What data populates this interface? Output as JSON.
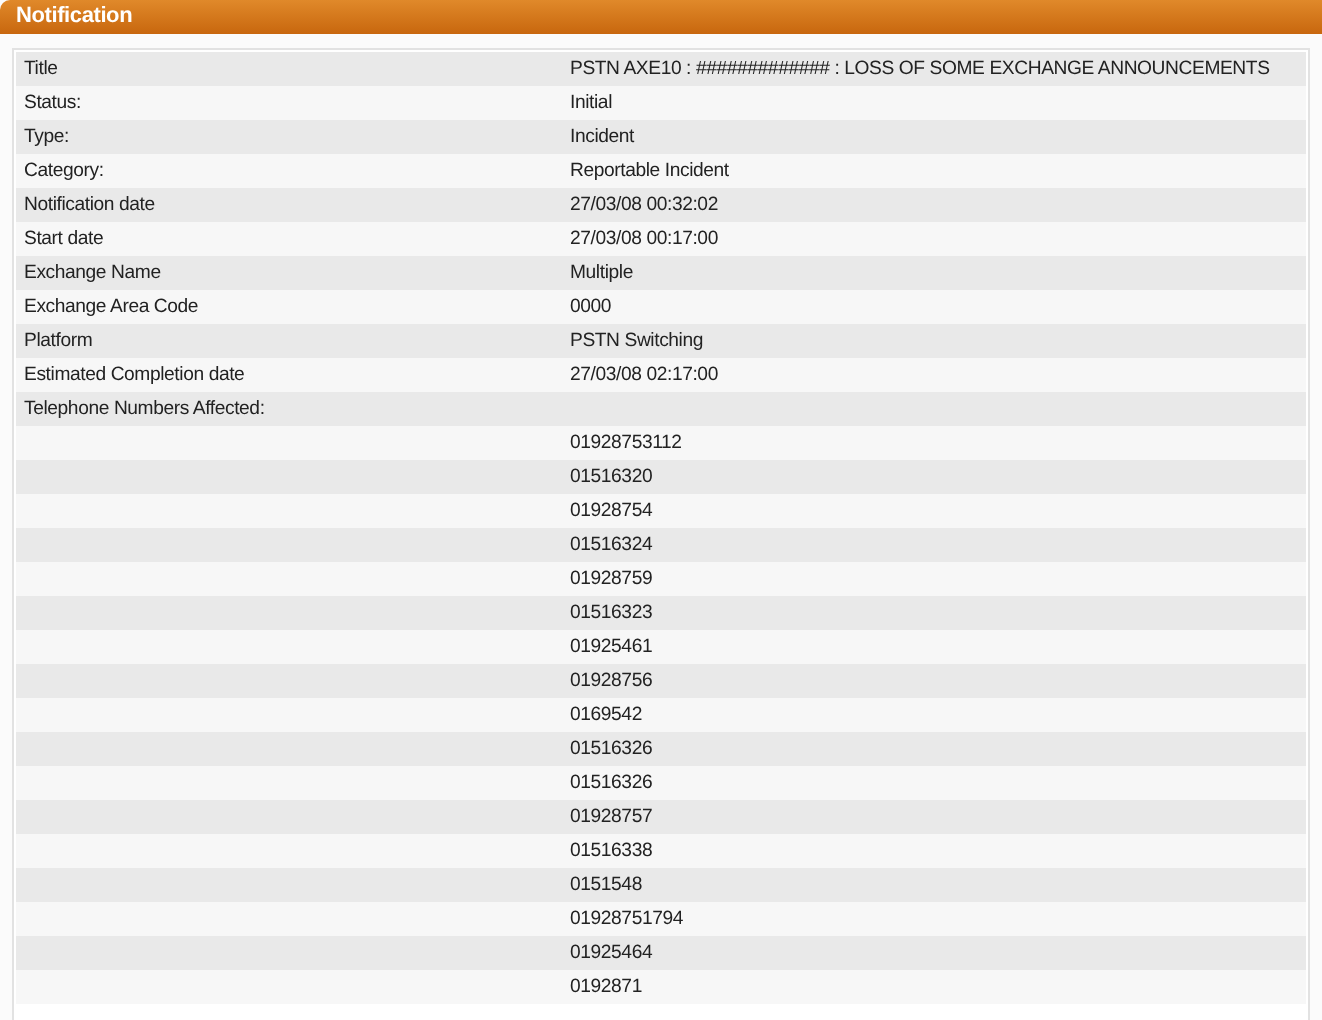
{
  "panel": {
    "title": "Notification"
  },
  "rows": [
    {
      "label": "Title",
      "value": "PSTN AXE10 : ############# : LOSS OF SOME EXCHANGE ANNOUNCEMENTS"
    },
    {
      "label": "Status:",
      "value": "Initial"
    },
    {
      "label": "Type:",
      "value": "Incident"
    },
    {
      "label": "Category:",
      "value": "Reportable Incident"
    },
    {
      "label": "Notification date",
      "value": "27/03/08 00:32:02"
    },
    {
      "label": "Start date",
      "value": "27/03/08 00:17:00"
    },
    {
      "label": "Exchange Name",
      "value": "Multiple"
    },
    {
      "label": "Exchange Area Code",
      "value": "0000"
    },
    {
      "label": "Platform",
      "value": "PSTN Switching"
    },
    {
      "label": "Estimated Completion date",
      "value": "27/03/08 02:17:00"
    },
    {
      "label": "Telephone Numbers Affected:"
    },
    {
      "value": "01928753112"
    },
    {
      "value": "01516320"
    },
    {
      "value": "01928754"
    },
    {
      "value": "01516324"
    },
    {
      "value": "01928759"
    },
    {
      "value": "01516323"
    },
    {
      "value": "01925461"
    },
    {
      "value": "01928756"
    },
    {
      "value": "0169542"
    },
    {
      "value": "01516326"
    },
    {
      "value": "01516326"
    },
    {
      "value": "01928757"
    },
    {
      "value": "01516338"
    },
    {
      "value": "0151548"
    },
    {
      "value": "01928751794"
    },
    {
      "value": "01925464"
    },
    {
      "value": "0192871"
    }
  ]
}
